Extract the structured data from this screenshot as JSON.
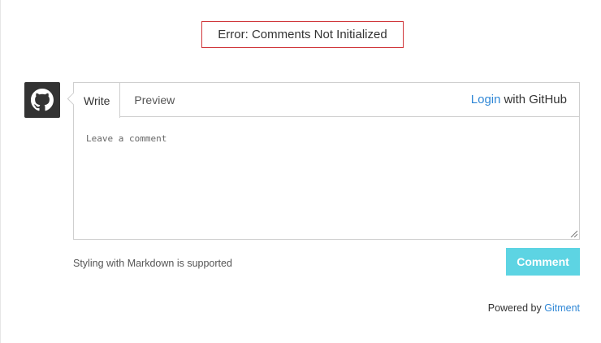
{
  "error": {
    "message": "Error: Comments Not Initialized"
  },
  "avatar": {
    "icon": "github-icon"
  },
  "tabs": [
    {
      "label": "Write",
      "active": true
    },
    {
      "label": "Preview",
      "active": false
    }
  ],
  "login": {
    "link_label": "Login",
    "suffix": "with GitHub"
  },
  "editor": {
    "placeholder": "Leave a comment"
  },
  "footer": {
    "markdown_note": "Styling with Markdown is supported",
    "comment_button": "Comment",
    "powered_by_label": "Powered by",
    "powered_by_link": "Gitment"
  },
  "colors": {
    "error_border": "#d0363a",
    "link": "#2f87d6",
    "button_bg": "#5dd4e3",
    "avatar_bg": "#333333"
  }
}
